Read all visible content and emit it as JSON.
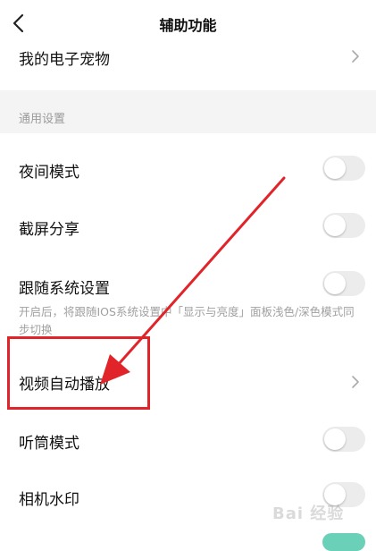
{
  "header": {
    "title": "辅助功能"
  },
  "pet_row": {
    "label": "我的电子宠物"
  },
  "section": {
    "title": "通用设置"
  },
  "settings": {
    "night_mode": {
      "label": "夜间模式",
      "enabled": false
    },
    "screenshot_share": {
      "label": "截屏分享",
      "enabled": false
    },
    "follow_system": {
      "label": "跟随系统设置",
      "enabled": false,
      "description": "开启后，将跟随IOS系统设置中「显示与亮度」面板浅色/深色模式同步切换"
    },
    "video_autoplay": {
      "label": "视频自动播放"
    },
    "earpiece_mode": {
      "label": "听筒模式",
      "enabled": false
    },
    "camera_watermark": {
      "label": "相机水印",
      "enabled": false
    }
  },
  "watermark": {
    "text": "Bai 经验"
  },
  "colors": {
    "annotation_red": "#e0242a",
    "toggle_off": "#ececec",
    "section_bg": "#f4f4f4",
    "toggle_on": "#6ad0b8"
  }
}
